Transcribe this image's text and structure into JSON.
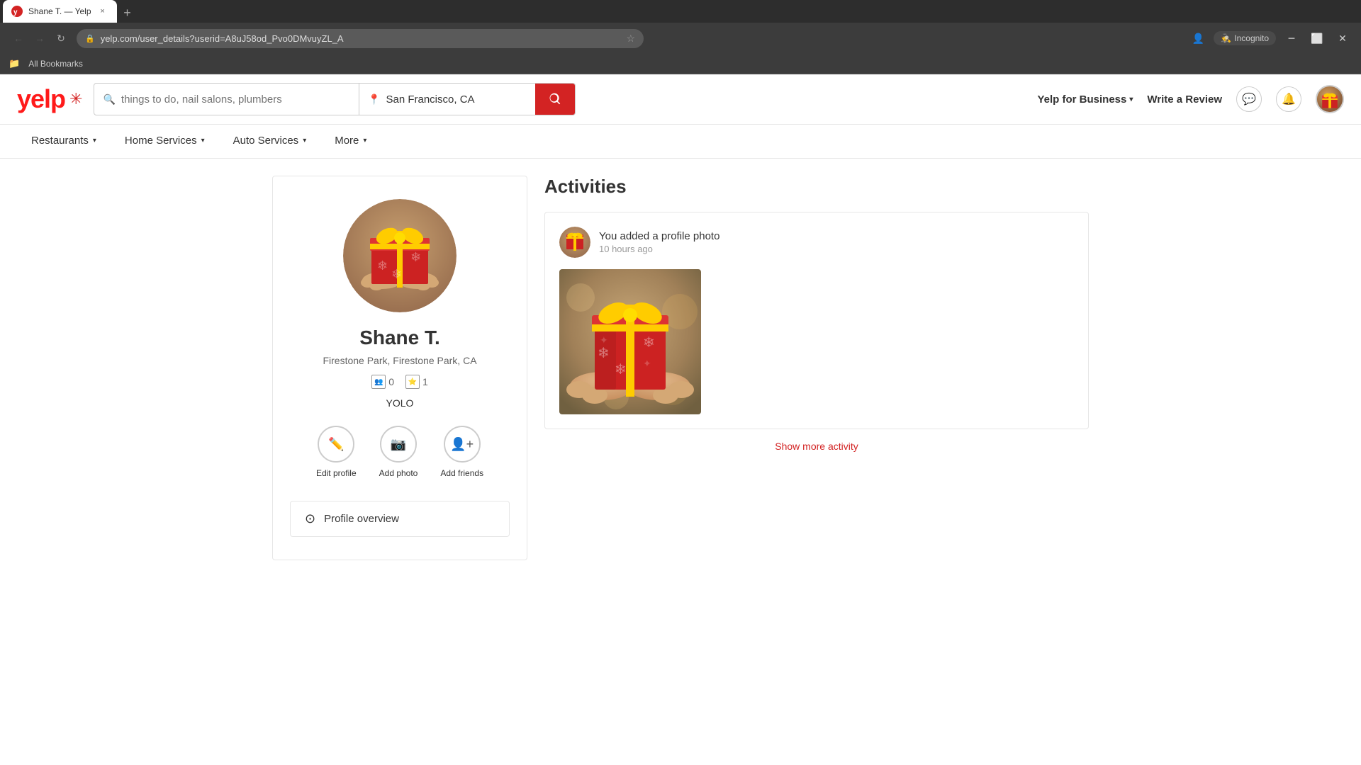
{
  "browser": {
    "tab_title": "Shane T. — Yelp",
    "url": "yelp.com/user_details?userid=A8uJ58od_Pvo0DMvuyZL_A",
    "back_btn": "←",
    "forward_btn": "→",
    "refresh_btn": "↻",
    "new_tab_btn": "+",
    "close_btn": "×",
    "incognito_label": "Incognito",
    "bookmarks_label": "All Bookmarks"
  },
  "header": {
    "logo_text": "yelp",
    "search_placeholder": "things to do, nail salons, plumbers",
    "location_value": "San Francisco, CA",
    "search_btn_label": "Search",
    "yelp_for_business_label": "Yelp for Business",
    "write_review_label": "Write a Review"
  },
  "nav": {
    "items": [
      {
        "label": "Restaurants",
        "has_dropdown": true
      },
      {
        "label": "Home Services",
        "has_dropdown": true
      },
      {
        "label": "Auto Services",
        "has_dropdown": true
      },
      {
        "label": "More",
        "has_dropdown": true
      }
    ]
  },
  "profile": {
    "name": "Shane T.",
    "location": "Firestone Park, Firestone Park, CA",
    "friends_count": "0",
    "reviews_count": "1",
    "motto": "YOLO",
    "edit_profile_label": "Edit profile",
    "add_photo_label": "Add photo",
    "add_friends_label": "Add friends",
    "overview_label": "Profile overview"
  },
  "activities": {
    "title": "Activities",
    "items": [
      {
        "text": "You added a profile photo",
        "time": "10 hours ago"
      }
    ],
    "show_more_label": "Show more activity"
  }
}
